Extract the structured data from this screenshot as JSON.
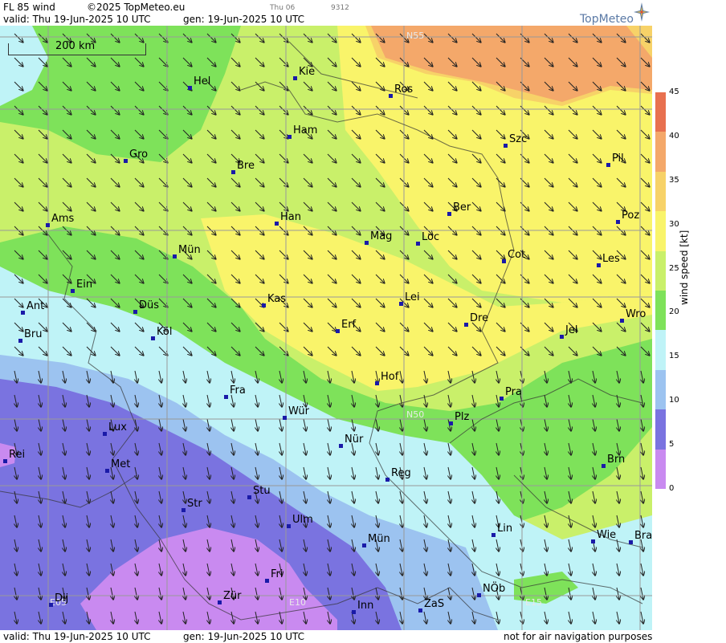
{
  "header": {
    "title": "FL 85 wind",
    "copyright": "©2025 TopMeteo.eu",
    "small_day": "Thu 06",
    "small_code": "9312",
    "valid": "valid:  Thu  19-Jun-2025  10 UTC",
    "gen": "gen: 19-Jun-2025 10 UTC"
  },
  "logo": {
    "text": "TopMeteo",
    "icon": "compass-star-icon"
  },
  "footer": {
    "valid": "valid:  Thu  19-Jun-2025  10 UTC",
    "gen": "gen: 19-Jun-2025 10 UTC",
    "note": "not for air navigation purposes"
  },
  "scale_bar": {
    "label": "200 km"
  },
  "grid_labels": [
    "N55",
    "N50",
    "E05",
    "E10",
    "E15"
  ],
  "legend": {
    "axis_label": "wind speed  [kt]",
    "ticks": [
      "45",
      "40",
      "35",
      "30",
      "25",
      "20",
      "15",
      "10",
      "5",
      "0"
    ],
    "colors": [
      "#e8704f",
      "#f4a86a",
      "#f7d268",
      "#f9f46a",
      "#c9f06a",
      "#7ee25a",
      "#bff3f7",
      "#9cc3f0",
      "#7a73e0",
      "#c98af0"
    ]
  },
  "cities": [
    {
      "name": "Kie"
    },
    {
      "name": "Hel"
    },
    {
      "name": "Ros"
    },
    {
      "name": "Ham"
    },
    {
      "name": "Szc"
    },
    {
      "name": "Gro"
    },
    {
      "name": "Bre"
    },
    {
      "name": "Pil"
    },
    {
      "name": "Ams"
    },
    {
      "name": "Han"
    },
    {
      "name": "Ber"
    },
    {
      "name": "Poz"
    },
    {
      "name": "Mag"
    },
    {
      "name": "Loc"
    },
    {
      "name": "Mün"
    },
    {
      "name": "Cot"
    },
    {
      "name": "Les"
    },
    {
      "name": "Ein"
    },
    {
      "name": "Kas"
    },
    {
      "name": "Lei"
    },
    {
      "name": "Ant"
    },
    {
      "name": "Düs"
    },
    {
      "name": "Dre"
    },
    {
      "name": "Wro"
    },
    {
      "name": "Erf"
    },
    {
      "name": "Bru"
    },
    {
      "name": "Köl"
    },
    {
      "name": "Jel"
    },
    {
      "name": "Hof"
    },
    {
      "name": "Fra"
    },
    {
      "name": "Pra"
    },
    {
      "name": "Wür"
    },
    {
      "name": "Plz"
    },
    {
      "name": "Lux"
    },
    {
      "name": "Nür"
    },
    {
      "name": "Rei"
    },
    {
      "name": "Met"
    },
    {
      "name": "Brn"
    },
    {
      "name": "Reg"
    },
    {
      "name": "Stu"
    },
    {
      "name": "Str"
    },
    {
      "name": "Ulm"
    },
    {
      "name": "Lin"
    },
    {
      "name": "Wie"
    },
    {
      "name": "Bra"
    },
    {
      "name": "Mün"
    },
    {
      "name": "Fri"
    },
    {
      "name": "NÖb"
    },
    {
      "name": "Dij"
    },
    {
      "name": "Zür"
    },
    {
      "name": "Inn"
    },
    {
      "name": "ZaS"
    }
  ]
}
